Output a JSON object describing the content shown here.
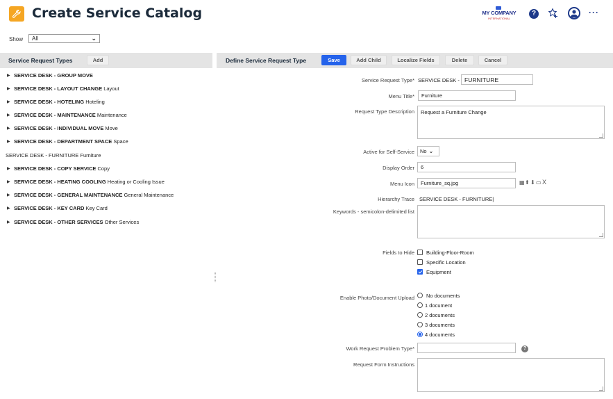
{
  "header": {
    "title": "Create Service Catalog",
    "logo_main": "MY COMPANY",
    "logo_sub": "INTERNATIONAL",
    "help_glyph": "?",
    "more_glyph": "···"
  },
  "filter": {
    "show_label": "Show",
    "show_value": "All"
  },
  "left_panel": {
    "title": "Service Request Types",
    "add_label": "Add",
    "items": [
      {
        "code": "SERVICE DESK - GROUP MOVE",
        "desc": "",
        "expandable": true
      },
      {
        "code": "SERVICE DESK - LAYOUT CHANGE",
        "desc": "Layout",
        "expandable": true
      },
      {
        "code": "SERVICE DESK - HOTELING",
        "desc": "Hoteling",
        "expandable": true
      },
      {
        "code": "SERVICE DESK - MAINTENANCE",
        "desc": "Maintenance",
        "expandable": true
      },
      {
        "code": "SERVICE DESK - INDIVIDUAL MOVE",
        "desc": "Move",
        "expandable": true
      },
      {
        "code": "SERVICE DESK - DEPARTMENT SPACE",
        "desc": "Space",
        "expandable": true
      },
      {
        "code": "SERVICE DESK - FURNITURE",
        "desc": "Furniture",
        "expandable": false
      },
      {
        "code": "SERVICE DESK - COPY SERVICE",
        "desc": "Copy",
        "expandable": true
      },
      {
        "code": "SERVICE DESK - HEATING COOLING",
        "desc": "Heating or Cooling Issue",
        "expandable": true
      },
      {
        "code": "SERVICE DESK - GENERAL MAINTENANCE",
        "desc": "General Maintenance",
        "expandable": true
      },
      {
        "code": "SERVICE DESK - KEY CARD",
        "desc": "Key Card",
        "expandable": true
      },
      {
        "code": "SERVICE DESK - OTHER SERVICES",
        "desc": "Other Services",
        "expandable": true
      }
    ]
  },
  "right_panel": {
    "title": "Define Service Request Type",
    "buttons": {
      "save": "Save",
      "add_child": "Add Child",
      "localize": "Localize Fields",
      "delete": "Delete",
      "cancel": "Cancel"
    },
    "fields": {
      "request_type_label": "Service Request Type*",
      "request_type_prefix": "SERVICE DESK -",
      "request_type_value": "FURNITURE",
      "menu_title_label": "Menu Title*",
      "menu_title_value": "Furniture",
      "description_label": "Request Type Description",
      "description_value": "Request a Furniture Change",
      "active_label": "Active for Self-Service",
      "active_value": "No",
      "display_order_label": "Display Order",
      "display_order_value": "6",
      "menu_icon_label": "Menu Icon",
      "menu_icon_value": "Furniture_sq.jpg",
      "hierarchy_label": "Hierarchy Trace",
      "hierarchy_value": "SERVICE DESK - FURNITURE|",
      "keywords_label": "Keywords - semicolon-delimited list",
      "keywords_value": "",
      "fields_hide_label": "Fields to Hide",
      "hide_options": [
        {
          "label": "Building-Floor-Room",
          "checked": false
        },
        {
          "label": "Specific Location",
          "checked": false
        },
        {
          "label": "Equipment",
          "checked": true
        }
      ],
      "upload_label": "Enable Photo/Document Upload",
      "upload_options": [
        {
          "label": "No documents",
          "selected": false
        },
        {
          "label": "1 document",
          "selected": false
        },
        {
          "label": "2 documents",
          "selected": false
        },
        {
          "label": "3 documents",
          "selected": false
        },
        {
          "label": "4 documents",
          "selected": true
        }
      ],
      "problem_type_label": "Work Request Problem Type*",
      "problem_type_value": "",
      "instructions_label": "Request Form Instructions",
      "instructions_value": ""
    }
  },
  "colors": {
    "primary": "#2563eb",
    "header_bar": "#e4e4e4",
    "app_icon": "#f5a623",
    "title": "#1b2a3a"
  }
}
